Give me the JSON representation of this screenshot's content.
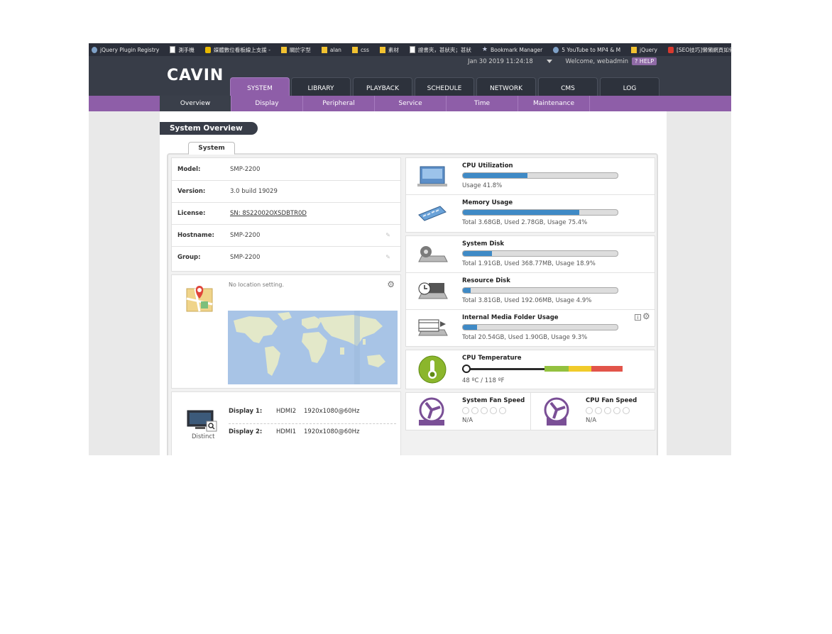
{
  "bookmarks": [
    {
      "icon": "swirl-icon",
      "label": "jQuery Plugin Registry"
    },
    {
      "icon": "page-icon",
      "label": "測手機"
    },
    {
      "icon": "c-icon",
      "label": "媒體數位看板線上支援 -"
    },
    {
      "icon": "folder-icon",
      "label": "關於字型"
    },
    {
      "icon": "folder-icon",
      "label": "alan"
    },
    {
      "icon": "folder-icon",
      "label": "css"
    },
    {
      "icon": "folder-icon",
      "label": "素材"
    },
    {
      "icon": "page-icon",
      "label": "證書夾，甚狀夾；甚狀"
    },
    {
      "icon": "star-icon",
      "label": "Bookmark Manager"
    },
    {
      "icon": "swirl-icon",
      "label": "5 YouTube to MP4 & M"
    },
    {
      "icon": "folder-icon",
      "label": "jQuery"
    },
    {
      "icon": "red-icon",
      "label": "[SEO技巧]懶懶網頁如何"
    }
  ],
  "header": {
    "logo": "CAVIN",
    "datetime": "Jan 30 2019 11:24:18",
    "welcome": "Welcome, webadmin",
    "help": "HELP",
    "tabs": [
      "SYSTEM",
      "LIBRARY",
      "PLAYBACK",
      "SCHEDULE",
      "NETWORK",
      "CMS",
      "LOG"
    ],
    "active_tab": "SYSTEM"
  },
  "submenu": {
    "items": [
      "Overview",
      "Display",
      "Peripheral",
      "Service",
      "Time",
      "Maintenance"
    ],
    "active": "Overview"
  },
  "page": {
    "title": "System Overview",
    "tab": "System"
  },
  "info": {
    "rows": [
      {
        "label": "Model:",
        "value": "SMP-2200",
        "editable": false,
        "link": false
      },
      {
        "label": "Version:",
        "value": "3.0 build 19029",
        "editable": false,
        "link": false
      },
      {
        "label": "License:",
        "value": "SN: 8S22002OXSDBTR0D",
        "editable": false,
        "link": true
      },
      {
        "label": "Hostname:",
        "value": "SMP-2200",
        "editable": true,
        "link": false
      },
      {
        "label": "Group:",
        "value": "SMP-2200",
        "editable": true,
        "link": false
      }
    ]
  },
  "location": {
    "text": "No location setting."
  },
  "display": {
    "mode": "Distinct",
    "outputs": [
      {
        "label": "Display 1:",
        "port": "HDMI2",
        "resolution": "1920x1080@60Hz"
      },
      {
        "label": "Display 2:",
        "port": "HDMI1",
        "resolution": "1920x1080@60Hz"
      }
    ]
  },
  "metrics": {
    "cpu": {
      "title": "CPU Utilization",
      "usage_percent": 41.8,
      "text": "Usage 41.8%"
    },
    "memory": {
      "title": "Memory Usage",
      "usage_percent": 75.4,
      "text": "Total 3.68GB, Used 2.78GB, Usage 75.4%"
    },
    "system_disk": {
      "title": "System Disk",
      "usage_percent": 18.9,
      "text": "Total 1.91GB, Used 368.77MB, Usage 18.9%"
    },
    "resource_disk": {
      "title": "Resource Disk",
      "usage_percent": 4.9,
      "text": "Total 3.81GB, Used 192.06MB, Usage 4.9%"
    },
    "media_folder": {
      "title": "Internal Media Folder Usage",
      "usage_percent": 9.3,
      "text": "Total 20.54GB, Used 1.90GB, Usage 9.3%"
    },
    "temperature": {
      "title": "CPU Temperature",
      "text": "48 ºC / 118 ºF"
    },
    "system_fan": {
      "title": "System Fan Speed",
      "text": "N/A"
    },
    "cpu_fan": {
      "title": "CPU Fan Speed",
      "text": "N/A"
    }
  },
  "colors": {
    "accent": "#8e5ea8",
    "header": "#383d48",
    "bar": "#3f8ac6"
  }
}
